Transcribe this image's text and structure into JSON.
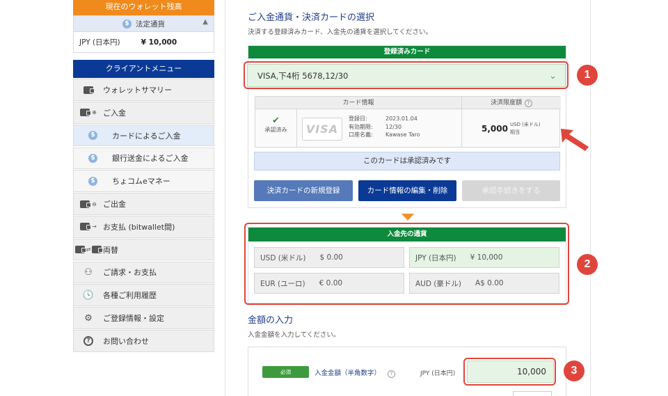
{
  "colors": {
    "accent_red": "#e0453c",
    "brand_navy": "#0b3a96",
    "green": "#0d8a3b",
    "orange": "#f08a1c"
  },
  "sidebar": {
    "wallet_header": "現在のウォレット残高",
    "legal_tender_label": "法定通貨",
    "coin_symbol": "$",
    "collapse_icon": "chevron-up-icon",
    "balance_currency": "JPY (日本円)",
    "balance_amount": "¥ 10,000",
    "menu_header": "クライアントメニュー",
    "items": [
      {
        "label": "ウォレットサマリー",
        "icon": "wallet-icon"
      },
      {
        "label": "ご入金",
        "icon": "deposit-icon"
      },
      {
        "label": "カードによるご入金",
        "icon": "coin-icon",
        "active": true
      },
      {
        "label": "銀行送金によるご入金",
        "icon": "coin-icon"
      },
      {
        "label": "ちょコムeマネー",
        "icon": "coin-icon"
      },
      {
        "label": "ご出金",
        "icon": "withdraw-icon"
      },
      {
        "label": "お支払 (bitwallet間)",
        "icon": "payment-icon"
      },
      {
        "label": "両替",
        "icon": "exchange-icon"
      },
      {
        "label": "ご請求・お支払",
        "icon": "people-icon"
      },
      {
        "label": "各種ご利用履歴",
        "icon": "history-icon"
      },
      {
        "label": "ご登録情報・設定",
        "icon": "gear-icon"
      },
      {
        "label": "お問い合わせ",
        "icon": "question-icon"
      }
    ]
  },
  "card_section": {
    "title": "ご入金通貨・決済カードの選択",
    "subtitle": "決済する登録済みカード、入金先の通貨を選択してください。",
    "registered_header": "登録済みカード",
    "selected_card": "VISA,下4桁 5678,12/30",
    "info_header": "カード情報",
    "limit_header": "決済限度額",
    "approved_label": "承認済み",
    "visa_text": "VISA",
    "details": [
      {
        "key": "登録日:",
        "value": "2023.01.04"
      },
      {
        "key": "有効期限:",
        "value": "12/30"
      },
      {
        "key": "口座名義:",
        "value": "Kawase Taro"
      }
    ],
    "limit_amount": "5,000",
    "limit_unit": "USD (米ドル)",
    "limit_note": "相当",
    "approved_banner": "このカードは承認済みです",
    "buttons": {
      "new": "決済カードの新規登録",
      "edit": "カード情報の編集・削除",
      "approve": "承認手続きをする"
    }
  },
  "currency_section": {
    "header": "入金先の通貨",
    "currencies": [
      {
        "name": "USD (米ドル)",
        "balance": "$ 0.00",
        "selected": false
      },
      {
        "name": "JPY (日本円)",
        "balance": "¥ 10,000",
        "selected": true
      },
      {
        "name": "EUR (ユーロ)",
        "balance": "€ 0.00",
        "selected": false
      },
      {
        "name": "AUD (豪ドル)",
        "balance": "A$ 0.00",
        "selected": false
      }
    ]
  },
  "amount_section": {
    "title": "金額の入力",
    "subtitle": "入金金額を入力してください。",
    "required_badge": "必須",
    "label": "入金金額（半角数字）",
    "currency": "JPY (日本円)",
    "value": "10,000"
  },
  "annotations": {
    "n1": "1",
    "n2": "2",
    "n3": "3"
  }
}
